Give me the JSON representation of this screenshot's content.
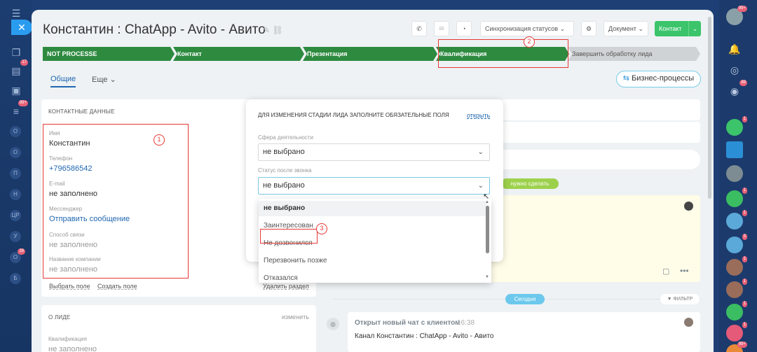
{
  "window": {
    "title": "Константин : ChatApp - Avito - Авито",
    "close_glyph": "✕"
  },
  "leftbar": {
    "badges": [
      "17",
      "99+",
      "39"
    ],
    "letters": [
      "О",
      "О",
      "П",
      "Н",
      "ЦР",
      "У",
      "О",
      "Б"
    ]
  },
  "toolbar": {
    "sync_status": "Синхронизация статусов",
    "document": "Документ",
    "contact": "Контакт"
  },
  "stages": [
    {
      "label": "NOT PROCESSE"
    },
    {
      "label": "Контакт"
    },
    {
      "label": "Презентация"
    },
    {
      "label": "Квалификация"
    },
    {
      "label": "Завершить обработку лида"
    }
  ],
  "annotations": {
    "one": "1",
    "two": "2",
    "three": "3"
  },
  "tabs": {
    "general": "Общие",
    "more": "Еще"
  },
  "bp_button": "Бизнес-процессы",
  "contact_card": {
    "header": "КОНТАКТНЫЕ ДАННЫЕ",
    "fields": [
      {
        "label": "Имя",
        "value": "Константин"
      },
      {
        "label": "Телефон",
        "value": "+796586542"
      },
      {
        "label": "E-mail",
        "value": "не заполнено"
      },
      {
        "label": "Мессенджер",
        "value": "Отправить сообщение"
      },
      {
        "label": "Способ связи",
        "value": "не заполнено"
      },
      {
        "label": "Название компании",
        "value": "не заполнено"
      }
    ],
    "select_field": "Выбрать поле",
    "create_field": "Создать поле",
    "delete_section": "Удалить раздел"
  },
  "lead_card": {
    "header": "О ЛИДЕ",
    "edit": "изменить",
    "fields": [
      {
        "label": "Квалификация",
        "value": "не заполнено"
      }
    ]
  },
  "popup": {
    "title": "ДЛЯ ИЗМЕНЕНИЯ СТАДИИ ЛИДА ЗАПОЛНИТЕ ОБЯЗАТЕЛЬНЫЕ ПОЛЯ",
    "open": "открыть",
    "field1_label": "Сфера деятельности",
    "field1_value": "не выбрано",
    "field2_label": "Статус после звонка",
    "field2_value": "не выбрано"
  },
  "dropdown": {
    "options": [
      "не выбрано",
      "Заинтересован",
      "Не дозвонился",
      "Перезвонить позже",
      "Отказался"
    ]
  },
  "timeline": {
    "todo": "нужно сделать",
    "today": "Сегодня",
    "filter": "ФИЛЬТР",
    "chat_title": "Открыт новый чат с клиентом",
    "chat_time": "16:38",
    "chat_text": "Канал Константин : ChatApp - Avito - Авито"
  },
  "rightbar": {
    "badges": [
      "99+",
      "89",
      "1",
      "1",
      "1",
      "3",
      "1",
      "1",
      "1",
      "1",
      "99+"
    ]
  },
  "colors": {
    "stage_green": "#2d8a3f",
    "accent_blue": "#2067b0",
    "highlight_red": "#e53935",
    "contact_green": "#3bc46a"
  }
}
